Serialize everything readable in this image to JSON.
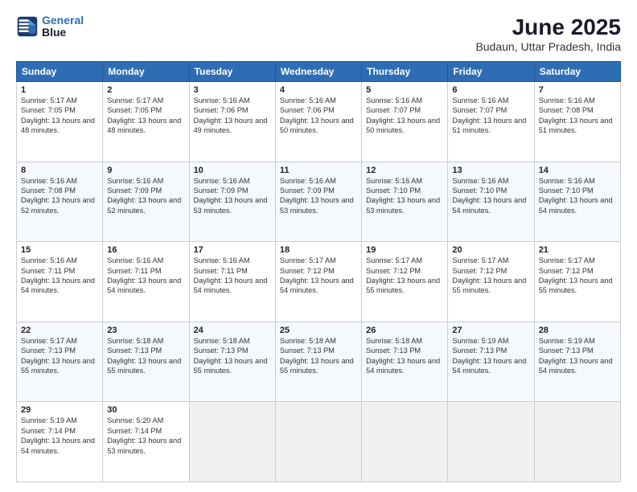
{
  "header": {
    "logo_line1": "General",
    "logo_line2": "Blue",
    "month_year": "June 2025",
    "location": "Budaun, Uttar Pradesh, India"
  },
  "weekdays": [
    "Sunday",
    "Monday",
    "Tuesday",
    "Wednesday",
    "Thursday",
    "Friday",
    "Saturday"
  ],
  "weeks": [
    [
      {
        "day": "1",
        "rise": "5:17 AM",
        "set": "7:05 PM",
        "daylight": "13 hours and 48 minutes."
      },
      {
        "day": "2",
        "rise": "5:17 AM",
        "set": "7:05 PM",
        "daylight": "13 hours and 48 minutes."
      },
      {
        "day": "3",
        "rise": "5:16 AM",
        "set": "7:06 PM",
        "daylight": "13 hours and 49 minutes."
      },
      {
        "day": "4",
        "rise": "5:16 AM",
        "set": "7:06 PM",
        "daylight": "13 hours and 50 minutes."
      },
      {
        "day": "5",
        "rise": "5:16 AM",
        "set": "7:07 PM",
        "daylight": "13 hours and 50 minutes."
      },
      {
        "day": "6",
        "rise": "5:16 AM",
        "set": "7:07 PM",
        "daylight": "13 hours and 51 minutes."
      },
      {
        "day": "7",
        "rise": "5:16 AM",
        "set": "7:08 PM",
        "daylight": "13 hours and 51 minutes."
      }
    ],
    [
      {
        "day": "8",
        "rise": "5:16 AM",
        "set": "7:08 PM",
        "daylight": "13 hours and 52 minutes."
      },
      {
        "day": "9",
        "rise": "5:16 AM",
        "set": "7:09 PM",
        "daylight": "13 hours and 52 minutes."
      },
      {
        "day": "10",
        "rise": "5:16 AM",
        "set": "7:09 PM",
        "daylight": "13 hours and 53 minutes."
      },
      {
        "day": "11",
        "rise": "5:16 AM",
        "set": "7:09 PM",
        "daylight": "13 hours and 53 minutes."
      },
      {
        "day": "12",
        "rise": "5:16 AM",
        "set": "7:10 PM",
        "daylight": "13 hours and 53 minutes."
      },
      {
        "day": "13",
        "rise": "5:16 AM",
        "set": "7:10 PM",
        "daylight": "13 hours and 54 minutes."
      },
      {
        "day": "14",
        "rise": "5:16 AM",
        "set": "7:10 PM",
        "daylight": "13 hours and 54 minutes."
      }
    ],
    [
      {
        "day": "15",
        "rise": "5:16 AM",
        "set": "7:11 PM",
        "daylight": "13 hours and 54 minutes."
      },
      {
        "day": "16",
        "rise": "5:16 AM",
        "set": "7:11 PM",
        "daylight": "13 hours and 54 minutes."
      },
      {
        "day": "17",
        "rise": "5:16 AM",
        "set": "7:11 PM",
        "daylight": "13 hours and 54 minutes."
      },
      {
        "day": "18",
        "rise": "5:17 AM",
        "set": "7:12 PM",
        "daylight": "13 hours and 54 minutes."
      },
      {
        "day": "19",
        "rise": "5:17 AM",
        "set": "7:12 PM",
        "daylight": "13 hours and 55 minutes."
      },
      {
        "day": "20",
        "rise": "5:17 AM",
        "set": "7:12 PM",
        "daylight": "13 hours and 55 minutes."
      },
      {
        "day": "21",
        "rise": "5:17 AM",
        "set": "7:12 PM",
        "daylight": "13 hours and 55 minutes."
      }
    ],
    [
      {
        "day": "22",
        "rise": "5:17 AM",
        "set": "7:13 PM",
        "daylight": "13 hours and 55 minutes."
      },
      {
        "day": "23",
        "rise": "5:18 AM",
        "set": "7:13 PM",
        "daylight": "13 hours and 55 minutes."
      },
      {
        "day": "24",
        "rise": "5:18 AM",
        "set": "7:13 PM",
        "daylight": "13 hours and 55 minutes."
      },
      {
        "day": "25",
        "rise": "5:18 AM",
        "set": "7:13 PM",
        "daylight": "13 hours and 55 minutes."
      },
      {
        "day": "26",
        "rise": "5:18 AM",
        "set": "7:13 PM",
        "daylight": "13 hours and 54 minutes."
      },
      {
        "day": "27",
        "rise": "5:19 AM",
        "set": "7:13 PM",
        "daylight": "13 hours and 54 minutes."
      },
      {
        "day": "28",
        "rise": "5:19 AM",
        "set": "7:13 PM",
        "daylight": "13 hours and 54 minutes."
      }
    ],
    [
      {
        "day": "29",
        "rise": "5:19 AM",
        "set": "7:14 PM",
        "daylight": "13 hours and 54 minutes."
      },
      {
        "day": "30",
        "rise": "5:20 AM",
        "set": "7:14 PM",
        "daylight": "13 hours and 53 minutes."
      },
      null,
      null,
      null,
      null,
      null
    ]
  ]
}
